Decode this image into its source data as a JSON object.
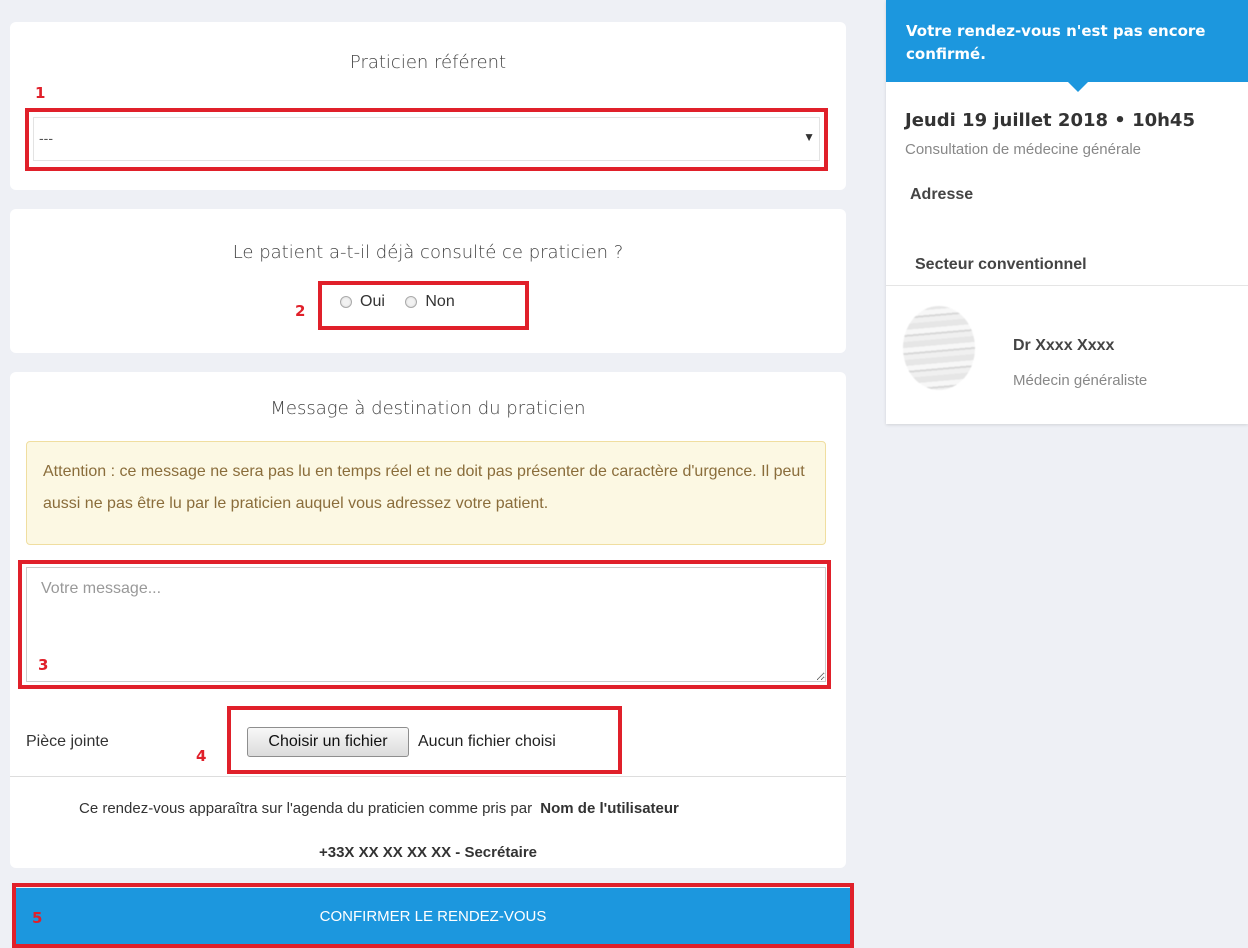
{
  "referent": {
    "title": "Praticien référent",
    "select_value": "---",
    "marker": "1"
  },
  "consulted": {
    "question": "Le patient a-t-il déjà consulté ce praticien ?",
    "options": [
      "Oui",
      "Non"
    ],
    "marker": "2"
  },
  "message": {
    "title": "Message à destination du praticien",
    "warning": "Attention : ce message ne sera pas lu en temps réel et ne doit pas présenter de caractère d'urgence. Il peut aussi ne pas être lu par le praticien auquel vous adressez votre patient.",
    "placeholder": "Votre message...",
    "marker": "3"
  },
  "attachment": {
    "label": "Pièce jointe",
    "button": "Choisir un fichier",
    "status": "Aucun fichier choisi",
    "marker": "4"
  },
  "footer": {
    "agenda_text": "Ce rendez-vous apparaîtra sur l'agenda du praticien comme pris par",
    "user_name": "Nom de l'utilisateur",
    "contact": "+33X XX XX XX XX - Secrétaire"
  },
  "confirm": {
    "label": "CONFIRMER LE RENDEZ-VOUS",
    "marker": "5"
  },
  "summary": {
    "banner": "Votre rendez-vous n'est pas encore confirmé.",
    "date": "Jeudi 19 juillet 2018 • 10h45",
    "consultation": "Consultation de médecine générale",
    "address_label": "Adresse",
    "sector_label": "Secteur conventionnel",
    "doctor_name": "Dr Xxxx Xxxx",
    "doctor_specialty": "Médecin généraliste"
  },
  "colors": {
    "accent": "#1c97de",
    "annotation_red": "#e0202a",
    "warning_bg": "#fcf8e3",
    "warning_text": "#8a6d3b",
    "page_bg": "#eef0f5"
  }
}
